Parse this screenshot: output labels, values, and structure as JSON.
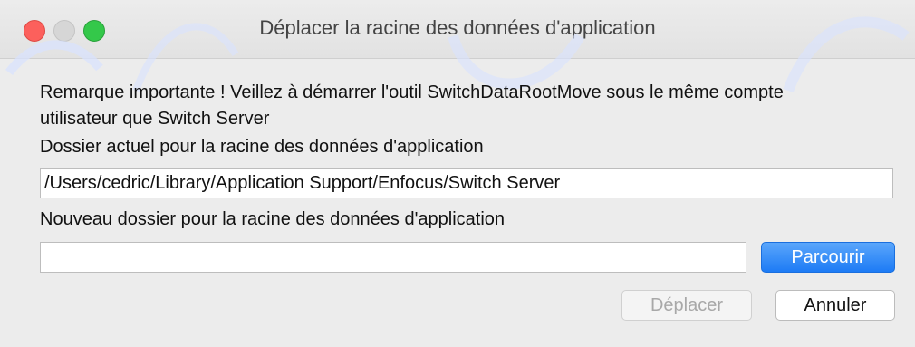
{
  "window": {
    "title": "Déplacer la racine des données d'application"
  },
  "dialog": {
    "notice": "Remarque importante ! Veillez à démarrer l'outil SwitchDataRootMove sous le même compte utilisateur que Switch Server",
    "current_label": "Dossier actuel pour la racine des données d'application",
    "current_value": "/Users/cedric/Library/Application Support/Enfocus/Switch Server",
    "new_label": "Nouveau dossier pour la racine des données d'application",
    "new_value": "",
    "browse_label": "Parcourir",
    "move_label": "Déplacer",
    "cancel_label": "Annuler"
  },
  "colors": {
    "close": "#fc605c",
    "minimize_inactive": "#d6d6d6",
    "zoom": "#34c84a",
    "accent": "#1d7bf5"
  }
}
